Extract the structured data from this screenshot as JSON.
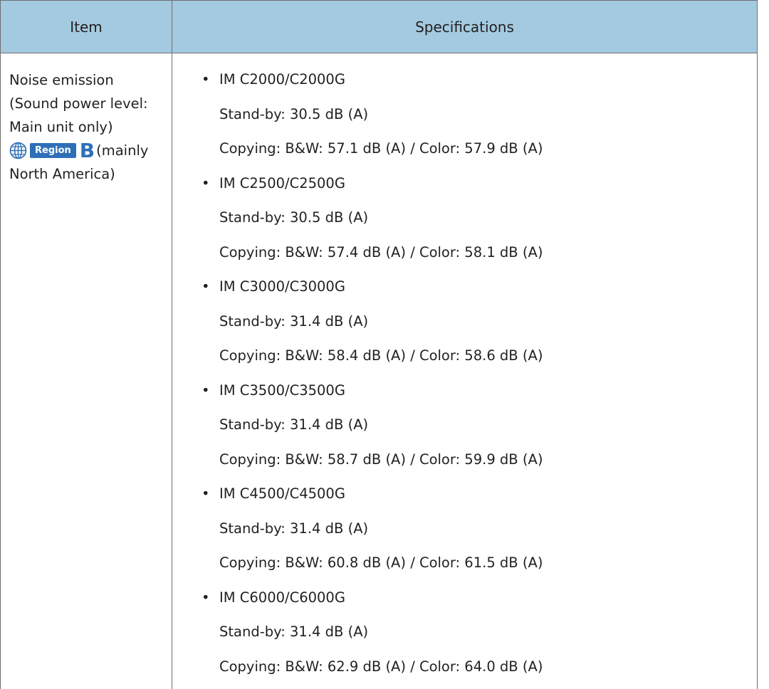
{
  "table": {
    "headers": {
      "item": "Item",
      "specifications": "Specifications"
    },
    "item": {
      "line1": "Noise emission",
      "line2": "(Sound power level:",
      "line3": "Main unit only)",
      "region_tag": "Region",
      "region_letter": "B",
      "region_note": "(mainly",
      "line5": "North America)"
    },
    "bullet_symbol": "•",
    "models": [
      {
        "name": "IM C2000/C2000G",
        "standby": "Stand-by: 30.5 dB (A)",
        "copying": "Copying: B&W: 57.1 dB (A) / Color: 57.9 dB (A)"
      },
      {
        "name": "IM C2500/C2500G",
        "standby": "Stand-by: 30.5 dB (A)",
        "copying": "Copying: B&W: 57.4 dB (A) / Color: 58.1 dB (A)"
      },
      {
        "name": "IM C3000/C3000G",
        "standby": "Stand-by: 31.4 dB (A)",
        "copying": "Copying: B&W: 58.4 dB (A) / Color: 58.6 dB (A)"
      },
      {
        "name": "IM C3500/C3500G",
        "standby": "Stand-by: 31.4 dB (A)",
        "copying": "Copying: B&W: 58.7 dB (A) / Color: 59.9 dB (A)"
      },
      {
        "name": "IM C4500/C4500G",
        "standby": "Stand-by: 31.4 dB (A)",
        "copying": "Copying: B&W: 60.8 dB (A) / Color: 61.5 dB (A)"
      },
      {
        "name": "IM C6000/C6000G",
        "standby": "Stand-by: 31.4 dB (A)",
        "copying": "Copying: B&W: 62.9 dB (A) / Color: 64.0 dB (A)"
      }
    ],
    "colors": {
      "header_bg": "#a3cae0",
      "border": "#6f6f6f",
      "text": "#231f20",
      "region_blue": "#2e6fb7"
    },
    "icons": {
      "region": "globe-icon"
    }
  }
}
